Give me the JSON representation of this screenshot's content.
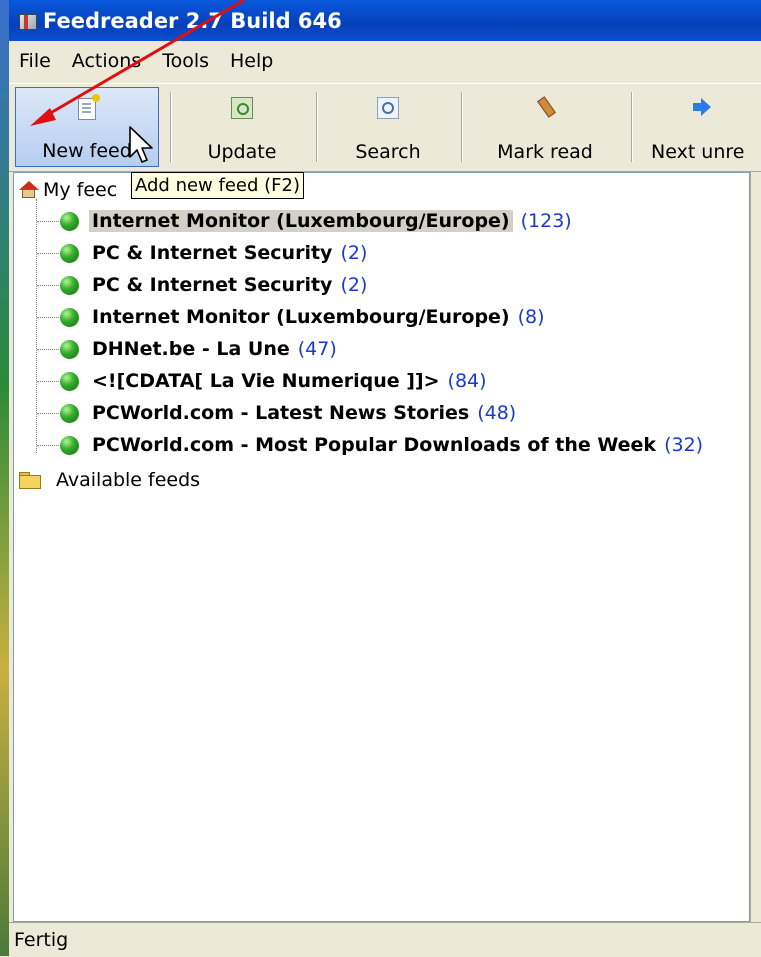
{
  "window": {
    "title": "Feedreader 2.7 Build 646"
  },
  "menu": {
    "items": [
      "File",
      "Actions",
      "Tools",
      "Help"
    ]
  },
  "toolbar": {
    "buttons": [
      {
        "label": "New feed",
        "icon": "new-feed-icon"
      },
      {
        "label": "Update",
        "icon": "update-icon"
      },
      {
        "label": "Search",
        "icon": "search-icon"
      },
      {
        "label": "Mark read",
        "icon": "mark-read-icon"
      },
      {
        "label": "Next unre",
        "icon": "next-unread-icon"
      }
    ]
  },
  "tooltip": {
    "text": "Add new feed (F2)"
  },
  "tree": {
    "root_label": "My feeds",
    "root_visible": "My feec",
    "feeds": [
      {
        "title": "Internet Monitor (Luxembourg/Europe)",
        "count": "(123)",
        "selected": true
      },
      {
        "title": "PC & Internet Security",
        "count": "(2)"
      },
      {
        "title": "PC & Internet Security",
        "count": "(2)"
      },
      {
        "title": "Internet Monitor (Luxembourg/Europe)",
        "count": "(8)"
      },
      {
        "title": "DHNet.be - La Une",
        "count": "(47)"
      },
      {
        "title": "<![CDATA[ La Vie Numerique ]]>",
        "count": "(84)"
      },
      {
        "title": "PCWorld.com - Latest News Stories",
        "count": "(48)"
      },
      {
        "title": "PCWorld.com - Most Popular Downloads of the Week",
        "count": "(32)"
      }
    ],
    "available_label": "Available feeds"
  },
  "status": {
    "text": "Fertig"
  },
  "colors": {
    "title_bar": "#0a59de",
    "feed_count": "#1a3acf",
    "annotation_arrow": "#e01010",
    "tooltip_bg": "#ffffe1"
  }
}
